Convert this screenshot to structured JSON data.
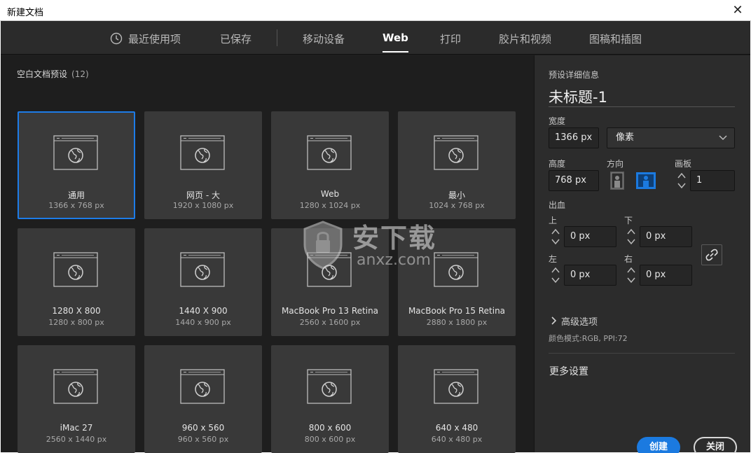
{
  "window": {
    "title": "新建文档",
    "close_glyph": "✕"
  },
  "tabs": [
    {
      "label": "最近使用项",
      "active": false,
      "icon": "clock-icon"
    },
    {
      "label": "已保存",
      "active": false
    },
    {
      "label": "移动设备",
      "active": false
    },
    {
      "label": "Web",
      "active": true
    },
    {
      "label": "打印",
      "active": false
    },
    {
      "label": "胶片和视频",
      "active": false
    },
    {
      "label": "图稿和插图",
      "active": false
    }
  ],
  "presets": {
    "title": "空白文档预设",
    "count": "(12)",
    "items": [
      {
        "name": "通用",
        "dims": "1366 x 768 px",
        "selected": true
      },
      {
        "name": "网页 - 大",
        "dims": "1920 x 1080 px"
      },
      {
        "name": "Web",
        "dims": "1280 x 1024 px"
      },
      {
        "name": "最小",
        "dims": "1024 x 768 px"
      },
      {
        "name": "1280 X 800",
        "dims": "1280 x 800 px"
      },
      {
        "name": "1440 X 900",
        "dims": "1440 x 900 px"
      },
      {
        "name": "MacBook Pro 13 Retina",
        "dims": "2560 x 1600 px"
      },
      {
        "name": "MacBook Pro 15 Retina",
        "dims": "2880 x 1800 px"
      },
      {
        "name": "iMac 27",
        "dims": "2560 x 1440 px"
      },
      {
        "name": "960 x 560",
        "dims": "960 x 560 px"
      },
      {
        "name": "800 x 600",
        "dims": "800 x 600 px"
      },
      {
        "name": "640 x 480",
        "dims": "640 x 480 px"
      }
    ]
  },
  "details": {
    "heading": "预设详细信息",
    "doc_name": "未标题-1",
    "width_label": "宽度",
    "width_value": "1366 px",
    "unit_value": "像素",
    "height_label": "高度",
    "height_value": "768 px",
    "orientation_label": "方向",
    "artboard_label": "画板",
    "artboard_value": "1",
    "bleed_label": "出血",
    "bleed": {
      "top_label": "上",
      "top_value": "0 px",
      "bottom_label": "下",
      "bottom_value": "0 px",
      "left_label": "左",
      "left_value": "0 px",
      "right_label": "右",
      "right_value": "0 px"
    },
    "advanced_label": "高级选项",
    "color_mode": "颜色模式:RGB, PPI:72",
    "more_settings": "更多设置",
    "create_button": "创建",
    "close_button": "关闭"
  },
  "watermark": {
    "cn": "安下载",
    "en": "anxz.com"
  },
  "colors": {
    "accent": "#1b7ae0",
    "panel": "#2c2c2c",
    "card": "#393939",
    "background": "#1e1e1e"
  }
}
